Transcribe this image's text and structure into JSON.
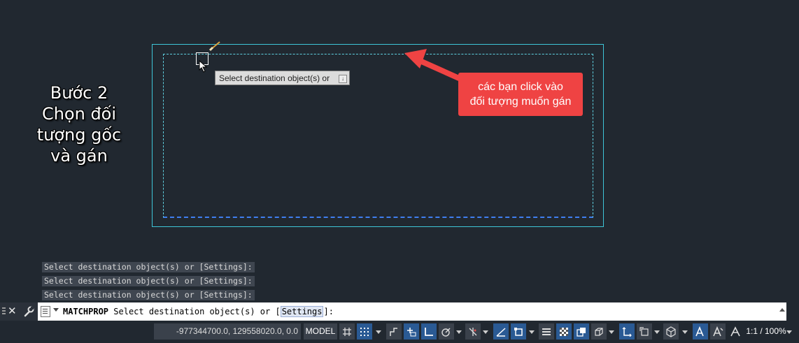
{
  "step_label": {
    "line1": "Bước 2",
    "line2": "Chọn đối",
    "line3": "tượng gốc",
    "line4": "và gán"
  },
  "tooltip": {
    "text": "Select destination object(s) or"
  },
  "callout": {
    "line1": "các bạn click vào",
    "line2": "đối tượng muốn gán"
  },
  "history": [
    "Select destination object(s) or [Settings]:",
    "Select destination object(s) or [Settings]:",
    "Select destination object(s) or [Settings]:"
  ],
  "command": {
    "name": "MATCHPROP",
    "prompt": "Select destination object(s) or [",
    "option": "Settings",
    "suffix": "]:"
  },
  "status": {
    "coordinates": "-977344700.0, 129558020.0, 0.0",
    "model": "MODEL",
    "scale": "1:1 / 100%"
  },
  "colors": {
    "background": "#212830",
    "selection_outer": "#3ec6d8",
    "selection_dashed": "#3f7ff0",
    "callout": "#ef4343",
    "active_toggle": "#2a5a94"
  },
  "icons": [
    "close-icon",
    "wrench-icon",
    "grid-icon",
    "snap-icon",
    "ortho-icon",
    "polar-icon",
    "osnap-icon",
    "annotation-icon",
    "workspace-icon"
  ]
}
